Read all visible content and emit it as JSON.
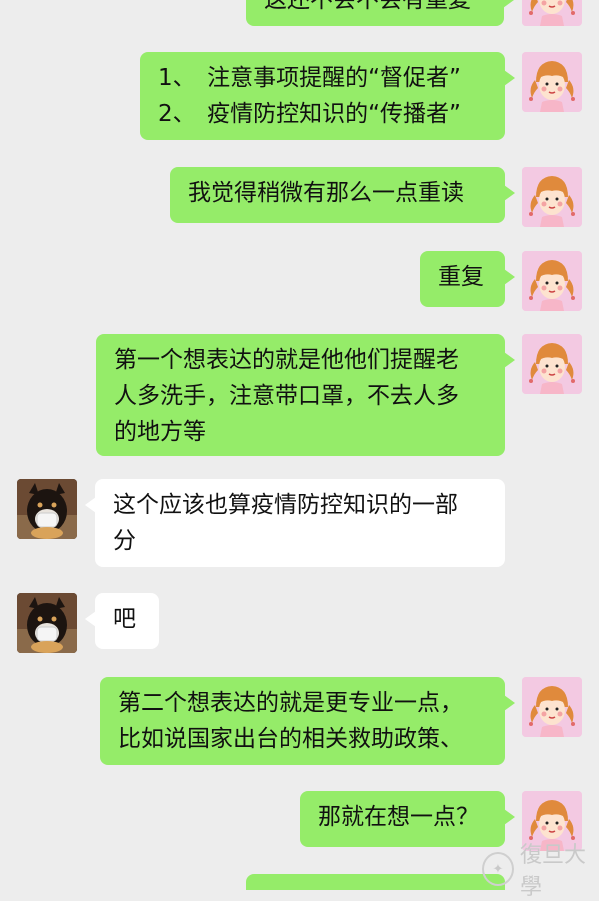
{
  "messages": [
    {
      "side": "me",
      "lines": [
        "这还不会不会有重复"
      ]
    },
    {
      "side": "me",
      "lines": [
        "1、　注意事项提醒的“督促者”",
        "2、　疫情防控知识的“传播者”"
      ]
    },
    {
      "side": "me",
      "lines": [
        "我觉得稍微有那么一点重读"
      ]
    },
    {
      "side": "me",
      "lines": [
        "重复"
      ]
    },
    {
      "side": "me",
      "lines": [
        "第一个想表达的就是他他们提醒老",
        "人多洗手，注意带口罩，不去人多",
        "的地方等"
      ]
    },
    {
      "side": "other",
      "lines": [
        "这个应该也算疫情防控知识的一部",
        "分"
      ]
    },
    {
      "side": "other",
      "lines": [
        "吧"
      ]
    },
    {
      "side": "me",
      "lines": [
        "第二个想表达的就是更专业一点，",
        "比如说国家出台的相关救助政策、"
      ]
    },
    {
      "side": "me",
      "lines": [
        "那就在想一点？"
      ]
    },
    {
      "side": "me",
      "lines": [
        ""
      ]
    }
  ],
  "avatars": {
    "me": "girl-avatar-icon",
    "other": "dog-avatar-icon"
  },
  "watermark": {
    "text": "復旦大學"
  },
  "colors": {
    "background": "#ededed",
    "my_bubble": "#95ec69",
    "other_bubble": "#ffffff"
  }
}
